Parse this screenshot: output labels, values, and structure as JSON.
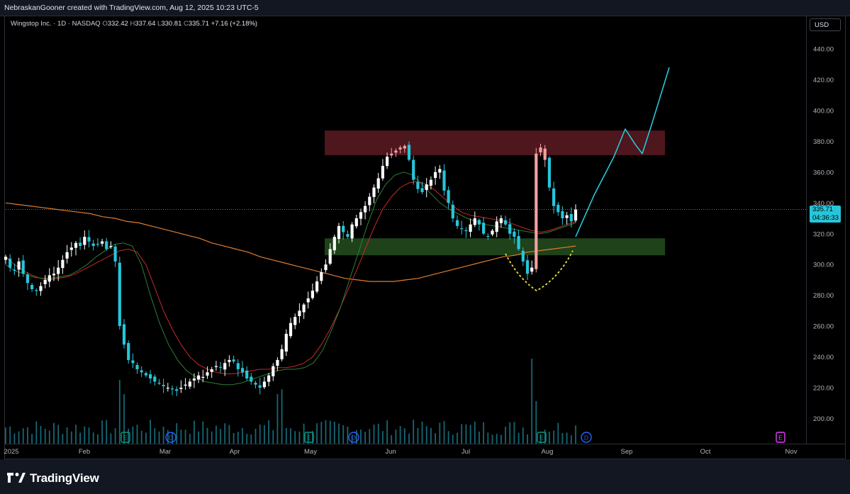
{
  "credit": "NebraskanGooner created with TradingView.com, Aug 12, 2025 10:23 UTC-5",
  "legend": {
    "symbol": "Wingstop Inc. · 1D · NASDAQ",
    "o_label": "O",
    "o": "332.42",
    "h_label": "H",
    "h": "337.64",
    "l_label": "L",
    "l": "330.81",
    "c_label": "C",
    "c": "335.71",
    "change": "+7.16 (+2.18%)"
  },
  "currency": "USD",
  "current_price": "335.71",
  "countdown": "04:36:33",
  "brand": "TradingView",
  "colors": {
    "up": "#ffffff",
    "down": "#26c6da",
    "up_peak": "#f4a0a0",
    "resistance_zone": "#5c1a22",
    "support_zone": "#244d1f",
    "ma_long": "#e27d2c",
    "ma_red": "#c62828",
    "ma_green": "#2e7d32",
    "projection": "#26c6da",
    "cup": "#f0e442",
    "volume": "#1d8a9c",
    "dividend_marker": "#2962ff",
    "earnings_marker": "#089981",
    "earnings_future": "#e040fb"
  },
  "chart_data": {
    "type": "candlestick",
    "title": "Wingstop Inc. · 1D · NASDAQ",
    "ylabel": "USD",
    "ylim": [
      185,
      450
    ],
    "y_ticks": [
      "440.00",
      "420.00",
      "400.00",
      "380.00",
      "360.00",
      "340.00",
      "320.00",
      "300.00",
      "280.00",
      "260.00",
      "240.00",
      "220.00",
      "200.00"
    ],
    "x_ticks": [
      "2025",
      "Feb",
      "Mar",
      "Apr",
      "May",
      "Jun",
      "Jul",
      "Aug",
      "Sep",
      "Oct",
      "Nov"
    ],
    "close_series": [
      305,
      298,
      296,
      302,
      294,
      288,
      284,
      283,
      286,
      290,
      293,
      294,
      298,
      303,
      308,
      311,
      314,
      312,
      318,
      315,
      312,
      313,
      315,
      310,
      312,
      302,
      260,
      248,
      238,
      236,
      232,
      230,
      228,
      226,
      224,
      223,
      221,
      220,
      219,
      218,
      220,
      222,
      224,
      226,
      228,
      227,
      230,
      232,
      234,
      233,
      236,
      238,
      237,
      232,
      230,
      226,
      224,
      222,
      220,
      224,
      228,
      234,
      238,
      245,
      255,
      262,
      266,
      270,
      274,
      278,
      283,
      289,
      295,
      300,
      310,
      318,
      325,
      321,
      318,
      326,
      330,
      334,
      338,
      344,
      350,
      356,
      364,
      370,
      372,
      374,
      376,
      377,
      368,
      355,
      349,
      347,
      352,
      355,
      360,
      362,
      348,
      340,
      330,
      325,
      323,
      322,
      326,
      330,
      326,
      320,
      318,
      322,
      328,
      330,
      326,
      320,
      318,
      310,
      302,
      294,
      298,
      372,
      376,
      368,
      350,
      338,
      334,
      330,
      332,
      328,
      335.71
    ],
    "resistance_zone": [
      371,
      387
    ],
    "support_zone": [
      306,
      317
    ],
    "ma_long": [
      340,
      339,
      338,
      337,
      336,
      335,
      334,
      333,
      331,
      330,
      328,
      327,
      325,
      323,
      321,
      319,
      317,
      314,
      312,
      310,
      308,
      305,
      303,
      301,
      299,
      297,
      295,
      293,
      291,
      290,
      289,
      289,
      289,
      290,
      291,
      293,
      295,
      297,
      299,
      301,
      303,
      305,
      306,
      308,
      309,
      310,
      311,
      312
    ],
    "ma_red": [
      305,
      300,
      296,
      293,
      291,
      290,
      291,
      292,
      294,
      297,
      300,
      303,
      306,
      309,
      310,
      308,
      300,
      285,
      270,
      258,
      248,
      240,
      235,
      232,
      230,
      229,
      229,
      230,
      231,
      232,
      232,
      233,
      233,
      234,
      236,
      240,
      248,
      258,
      270,
      283,
      296,
      310,
      324,
      336,
      344,
      350,
      353,
      354,
      352,
      348,
      343,
      338,
      334,
      332,
      331,
      330,
      329,
      328,
      326,
      324,
      322,
      321,
      322,
      324,
      326,
      328
    ],
    "ma_green": [
      300,
      296,
      294,
      292,
      291,
      291,
      292,
      293,
      296,
      300,
      305,
      309,
      313,
      314,
      312,
      300,
      280,
      262,
      248,
      238,
      231,
      227,
      224,
      223,
      222,
      222,
      223,
      225,
      227,
      229,
      231,
      232,
      232,
      233,
      236,
      244,
      257,
      272,
      290,
      308,
      326,
      342,
      352,
      358,
      360,
      358,
      352,
      346,
      340,
      336,
      333,
      330,
      328,
      326,
      325,
      324,
      323,
      322,
      321,
      320,
      321,
      323,
      325,
      327
    ],
    "projection": [
      {
        "date": "Aug 12",
        "y": 318
      },
      {
        "date": "Aug 20",
        "y": 345
      },
      {
        "date": "Aug 28",
        "y": 370
      },
      {
        "date": "Sep 3",
        "y": 388
      },
      {
        "date": "Sep 8",
        "y": 378
      },
      {
        "date": "Sep 11",
        "y": 372
      },
      {
        "date": "Sep 16",
        "y": 392
      },
      {
        "date": "Sep 22",
        "y": 428
      }
    ],
    "cup_pattern": [
      {
        "date": "Jul 20",
        "y": 307
      },
      {
        "date": "Jul 27",
        "y": 287
      },
      {
        "date": "Aug 1",
        "y": 283
      },
      {
        "date": "Aug 6",
        "y": 291
      },
      {
        "date": "Aug 12",
        "y": 309
      }
    ],
    "events": [
      {
        "type": "E",
        "date": "Feb 19"
      },
      {
        "type": "D",
        "date": "Mar 3"
      },
      {
        "type": "E",
        "date": "May 1"
      },
      {
        "type": "D",
        "date": "May 16"
      },
      {
        "type": "E",
        "date": "Jul 30"
      },
      {
        "type": "D",
        "date": "Aug 22"
      },
      {
        "type": "E",
        "date": "Oct 29"
      }
    ],
    "grid": false
  }
}
